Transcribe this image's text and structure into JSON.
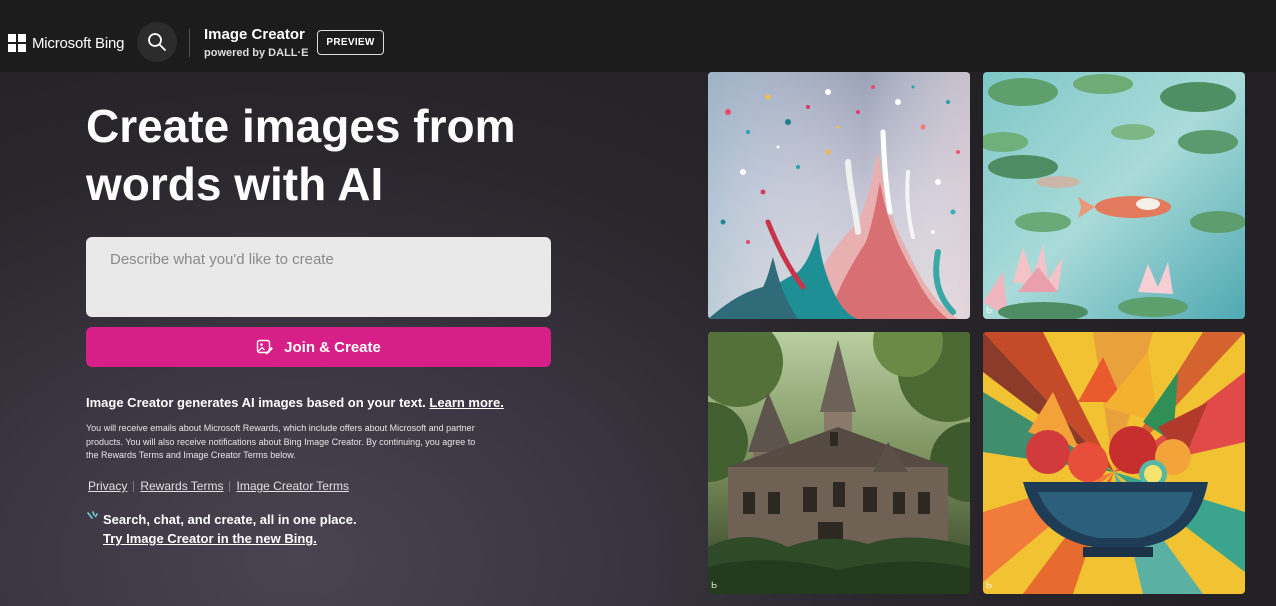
{
  "header": {
    "brand": "Microsoft Bing",
    "app_title": "Image Creator",
    "app_subtitle": "powered by DALL·E",
    "badge": "PREVIEW",
    "search_icon": "search-icon"
  },
  "hero": {
    "title_line1": "Create images from",
    "title_line2": "words with AI"
  },
  "prompt": {
    "placeholder": "Describe what you'd like to create",
    "value": ""
  },
  "cta": {
    "label": "Join & Create",
    "icon": "image-edit-icon",
    "color": "#d61f87"
  },
  "info": {
    "text": "Image Creator generates AI images based on your text.",
    "learn_more": "Learn more."
  },
  "disclaimer": "You will receive emails about Microsoft Rewards, which include offers about Microsoft and partner products. You will also receive notifications about Bing Image Creator. By continuing, you agree to the Rewards Terms and Image Creator Terms below.",
  "legal_links": [
    "Privacy",
    "Rewards Terms",
    "Image Creator Terms"
  ],
  "promo": {
    "line1": "Search, chat, and create, all in one place.",
    "line2": "Try Image Creator in the new Bing."
  },
  "gallery": {
    "images": [
      "paint-splash",
      "koi-pond",
      "fairytale-house",
      "fruit-bowl"
    ],
    "tile_mark": "Ь"
  }
}
